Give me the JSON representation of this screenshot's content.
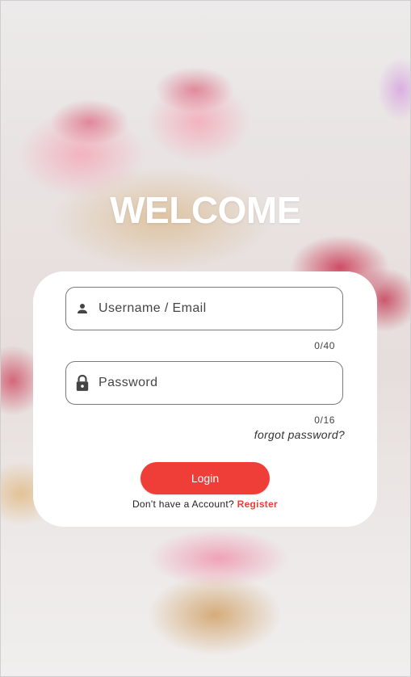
{
  "colors": {
    "accent": "#ef3d37",
    "card_background": "#ffffff",
    "field_border": "#7a7a7a",
    "welcome_text": "#ffffff"
  },
  "header": {
    "title": "WELCOME"
  },
  "form": {
    "username": {
      "icon": "person-icon",
      "placeholder": "Username / Email",
      "value": "",
      "counter": "0/40"
    },
    "password": {
      "icon": "lock-icon",
      "placeholder": "Password",
      "value": "",
      "counter": "0/16"
    },
    "forgot_label": "forgot password?",
    "login_label": "Login",
    "signup_prompt": "Don't have a Account?",
    "register_label": "Register"
  }
}
